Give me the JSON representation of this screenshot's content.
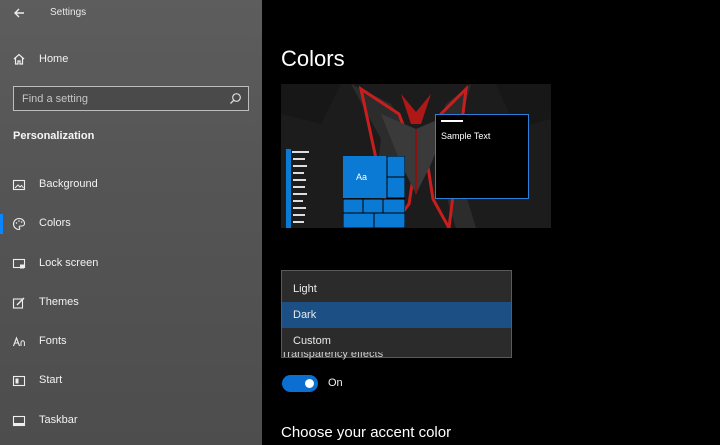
{
  "window": {
    "title": "Settings",
    "icons": {
      "back": "back-arrow-icon"
    }
  },
  "sidebar": {
    "home_label": "Home",
    "search": {
      "placeholder": "Find a setting"
    },
    "section_title": "Personalization",
    "items": [
      {
        "label": "Background",
        "icon": "background-icon"
      },
      {
        "label": "Colors",
        "icon": "palette-icon",
        "selected": true
      },
      {
        "label": "Lock screen",
        "icon": "lock-screen-icon"
      },
      {
        "label": "Themes",
        "icon": "themes-icon"
      },
      {
        "label": "Fonts",
        "icon": "fonts-icon"
      },
      {
        "label": "Start",
        "icon": "start-icon"
      },
      {
        "label": "Taskbar",
        "icon": "taskbar-icon"
      }
    ]
  },
  "main": {
    "title": "Colors",
    "preview": {
      "tile_label": "Aa",
      "sample_text": "Sample Text"
    },
    "color_mode": {
      "options": [
        "Light",
        "Dark",
        "Custom"
      ],
      "selected": "Dark"
    },
    "transparency": {
      "label": "Transparency effects",
      "state_label": "On",
      "enabled": true
    },
    "accent_title": "Choose your accent color"
  },
  "colors": {
    "accent": "#0a6fd1",
    "sidebar_bg": "#555555",
    "main_bg": "#000000",
    "selection": "#1c4f83"
  }
}
